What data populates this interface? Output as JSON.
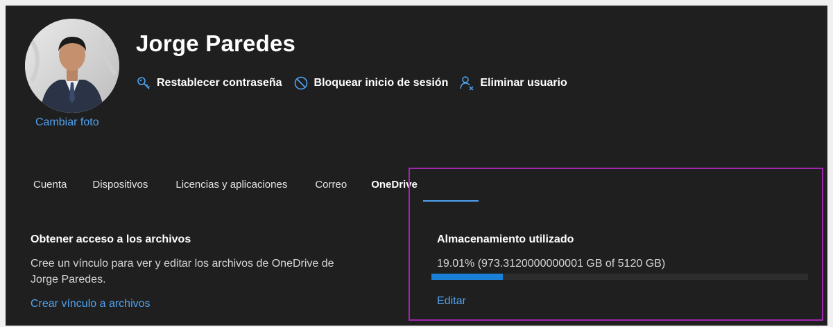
{
  "profile": {
    "name": "Jorge Paredes",
    "change_photo_label": "Cambiar foto",
    "avatar_icon": "person-photo"
  },
  "actions": [
    {
      "label": "Restablecer contraseña",
      "icon": "key-icon"
    },
    {
      "label": "Bloquear inicio de sesión",
      "icon": "block-icon"
    },
    {
      "label": "Eliminar usuario",
      "icon": "remove-user-icon"
    }
  ],
  "tabs": [
    {
      "label": "Cuenta",
      "active": false
    },
    {
      "label": "Dispositivos",
      "active": false
    },
    {
      "label": "Licencias y aplicaciones",
      "active": false
    },
    {
      "label": "Correo",
      "active": false
    },
    {
      "label": "OneDrive",
      "active": true
    }
  ],
  "files_access": {
    "title": "Obtener acceso a los archivos",
    "description_line1": "Cree un vínculo para ver y editar los archivos de OneDrive de",
    "description_line2": "Jorge Paredes.",
    "link_label": "Crear vínculo a archivos"
  },
  "storage": {
    "title": "Almacenamiento utilizado",
    "usage_text": "19.01% (973.3120000000001 GB of 5120 GB)",
    "used_fraction": 0.1901,
    "edit_label": "Editar"
  },
  "colors": {
    "accent": "#4fa3f3",
    "bar_fill": "#1a7fd6",
    "highlight_border": "#a126b0",
    "panel_bg": "#1f1f1f"
  }
}
